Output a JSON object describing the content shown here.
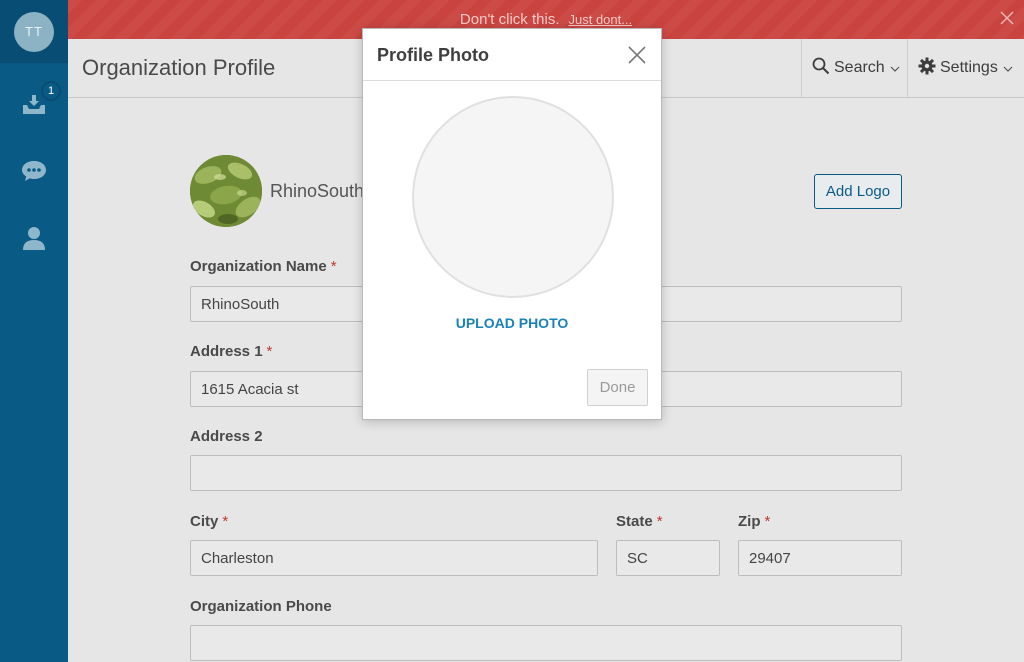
{
  "user": {
    "initials": "TT"
  },
  "sidebar": {
    "inbox_badge": "1",
    "items": [
      {
        "icon": "inbox-download-icon"
      },
      {
        "icon": "chat-bubble-icon"
      },
      {
        "icon": "person-icon"
      }
    ]
  },
  "banner": {
    "message": "Don't click this.",
    "link": "Just dont..."
  },
  "header": {
    "title": "Organization Profile",
    "search_label": "Search",
    "settings_label": "Settings"
  },
  "org": {
    "name": "RhinoSouth",
    "add_logo_label": "Add Logo"
  },
  "form": {
    "org_name_label": "Organization Name",
    "org_name_value": "RhinoSouth",
    "address1_label": "Address 1",
    "address1_value": "1615 Acacia st",
    "address2_label": "Address 2",
    "address2_value": "",
    "city_label": "City",
    "city_value": "Charleston",
    "state_label": "State",
    "state_value": "SC",
    "zip_label": "Zip",
    "zip_value": "29407",
    "phone_label": "Organization Phone",
    "phone_value": "",
    "required_marker": "*"
  },
  "modal": {
    "title": "Profile Photo",
    "upload_label": "UPLOAD PHOTO",
    "done_label": "Done"
  },
  "colors": {
    "sidebar": "#0a5a86",
    "banner": "#cc4b47",
    "accent": "#1a82b8",
    "required": "#c0392b"
  }
}
